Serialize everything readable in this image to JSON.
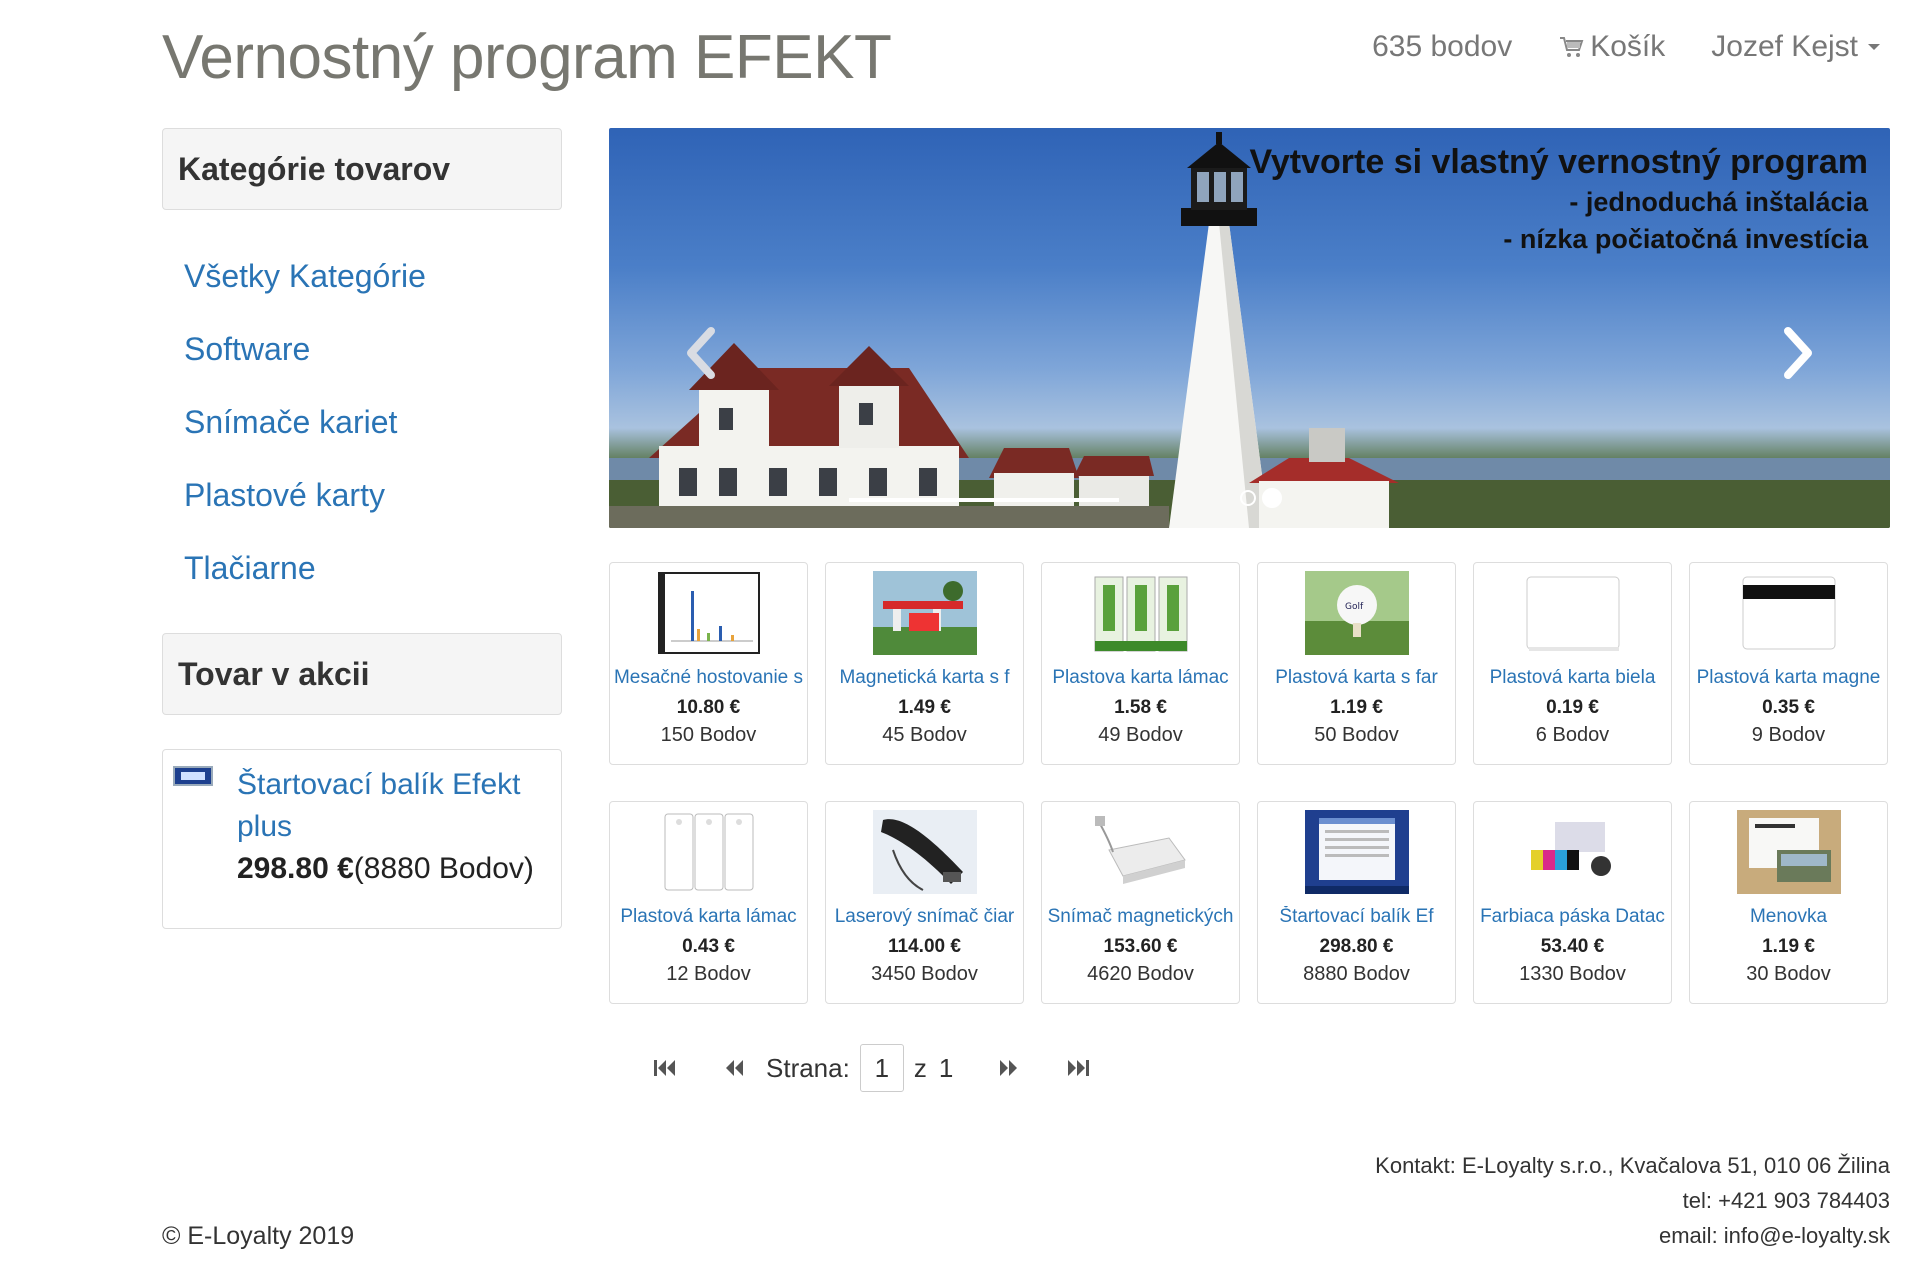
{
  "header": {
    "title": "Vernostný program EFEKT",
    "points": "635 bodov",
    "cart": "Košík",
    "user": "Jozef Kejst"
  },
  "sidebar": {
    "categories_title": "Kategórie tovarov",
    "categories": [
      {
        "label": "Všetky Kategórie"
      },
      {
        "label": "Software"
      },
      {
        "label": "Snímače kariet"
      },
      {
        "label": "Plastové karty"
      },
      {
        "label": "Tlačiarne"
      }
    ],
    "promo_title": "Tovar v akcii",
    "promo": {
      "name": "Štartovací balík Efekt plus",
      "price": "298.80 €",
      "points": "(8880 Bodov)"
    }
  },
  "carousel": {
    "line1": "Vytvorte si vlastný vernostný program",
    "line2": "- jednoduchá inštalácia",
    "line3": "- nízka počiatočná investícia"
  },
  "products": [
    {
      "name": "Mesačné hostovanie s",
      "price": "10.80 €",
      "points": "150 Bodov",
      "icon": "chart-screenshot"
    },
    {
      "name": "Magnetická karta s f",
      "price": "1.49 €",
      "points": "45 Bodov",
      "icon": "gas-station-card"
    },
    {
      "name": "Plastova karta lámac",
      "price": "1.58 €",
      "points": "49 Bodov",
      "icon": "breakable-cards"
    },
    {
      "name": "Plastová karta s far",
      "price": "1.19 €",
      "points": "50 Bodov",
      "icon": "golf-ball-card"
    },
    {
      "name": "Plastová karta biela",
      "price": "0.19 €",
      "points": "6 Bodov",
      "icon": "white-card"
    },
    {
      "name": "Plastová karta magne",
      "price": "0.35 €",
      "points": "9 Bodov",
      "icon": "magnetic-card"
    },
    {
      "name": "Plastová karta lámac",
      "price": "0.43 €",
      "points": "12 Bodov",
      "icon": "white-breakable-card"
    },
    {
      "name": "Laserový snímač čiar",
      "price": "114.00 €",
      "points": "3450 Bodov",
      "icon": "barcode-scanner"
    },
    {
      "name": "Snímač magnetických",
      "price": "153.60 €",
      "points": "4620 Bodov",
      "icon": "magnetic-reader"
    },
    {
      "name": "Štartovací balík Ef",
      "price": "298.80 €",
      "points": "8880 Bodov",
      "icon": "software-screenshot"
    },
    {
      "name": "Farbiaca páska Datac",
      "price": "53.40 €",
      "points": "1330 Bodov",
      "icon": "color-ribbon"
    },
    {
      "name": "Menovka",
      "price": "1.19 €",
      "points": "30 Bodov",
      "icon": "name-badge"
    }
  ],
  "pager": {
    "label": "Strana:",
    "current": "1",
    "of": "z",
    "total": "1"
  },
  "footer": {
    "copyright": "© E-Loyalty 2019",
    "contact": "Kontakt:  E-Loyalty s.r.o., Kvačalova 51, 010 06 Žilina",
    "phone": "tel: +421 903 784403",
    "email": "email: info@e-loyalty.sk"
  },
  "colors": {
    "link": "#2a74b5",
    "title": "#777770",
    "panel": "#f5f5f5"
  }
}
